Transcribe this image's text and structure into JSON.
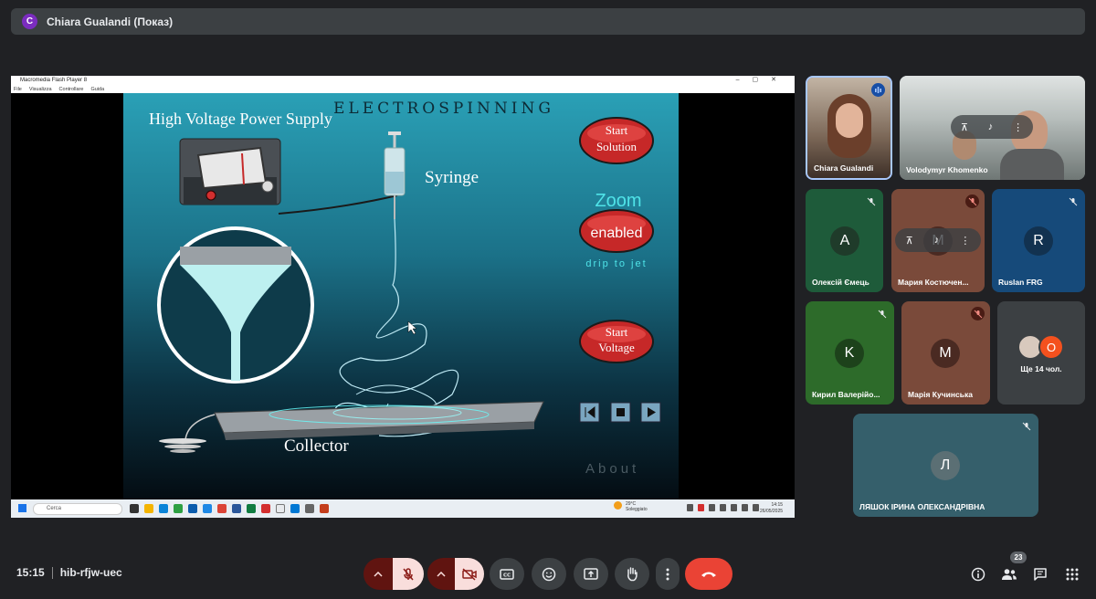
{
  "presenter_bar": {
    "avatar_letter": "C",
    "title": "Chiara Gualandi (Показ)"
  },
  "shared_window": {
    "title": "Macromedia Flash Player 8",
    "menu": [
      "File",
      "Visualizza",
      "Controllare",
      "Guida"
    ],
    "app": {
      "heading": "ELECTROSPINNING",
      "power_supply_label": "High Voltage Power Supply",
      "syringe_label": "Syringe",
      "collector_label": "Collector",
      "start_solution": "Start\nSolution",
      "zoom_label": "Zoom",
      "zoom_button": "enabled",
      "drip_label": "drip to jet",
      "start_voltage": "Start\nVoltage",
      "about_label": "About"
    },
    "taskbar": {
      "search_placeholder": "Cerca",
      "weather_temp": "29°C",
      "weather_desc": "Soleggiato",
      "time": "14:15",
      "date": "26/05/2025"
    }
  },
  "participants": [
    {
      "name": "Chiara Gualandi",
      "active_speaker": true
    },
    {
      "name": "Volodymyr Khomenko"
    },
    {
      "name": "Олексій Ємець",
      "initial": "A",
      "bg": "#1e5b3a",
      "avatar": "#1f3b2a"
    },
    {
      "name": "Мария Костюченко",
      "name_display": "Мария Костючен...",
      "initial": "M",
      "bg": "#7a4a3a",
      "avatar": "#4a2a22"
    },
    {
      "name": "Ruslan FRG",
      "initial": "R",
      "bg": "#164a7a",
      "avatar": "#123250"
    },
    {
      "name": "Кирил Валерійович",
      "name_display": "Кирил Валерійо...",
      "initial": "K",
      "bg": "#2d6b2a",
      "avatar": "#1d421b"
    },
    {
      "name": "Марія Кучинська",
      "initial": "M",
      "bg": "#7a4a3a",
      "avatar": "#4a2a22"
    },
    {
      "name": "Ще 14 чол.",
      "extra_initial": "O"
    },
    {
      "name": "ЛЯШОК ІРИНА ОЛЕКСАНДРІВНА",
      "initial": "Л",
      "bg": "#355f6b",
      "avatar": "#5b6f74"
    }
  ],
  "meeting": {
    "time": "15:15",
    "code": "hib-rfjw-uec",
    "participant_count": "23"
  },
  "icons": {
    "mic_off": "mic-off-icon",
    "cam_off": "camera-off-icon",
    "captions": "captions-icon",
    "emoji": "emoji-icon",
    "present": "present-icon",
    "hand": "raise-hand-icon",
    "more": "more-vert-icon",
    "hangup": "call-end-icon",
    "info": "info-icon",
    "people": "people-icon",
    "chat": "chat-icon",
    "apps": "apps-icon"
  },
  "colors": {
    "hangup": "#ea4335",
    "muted_bg": "#f9dedc",
    "muted_fg": "#8c1d18",
    "dark_red": "#601410"
  }
}
